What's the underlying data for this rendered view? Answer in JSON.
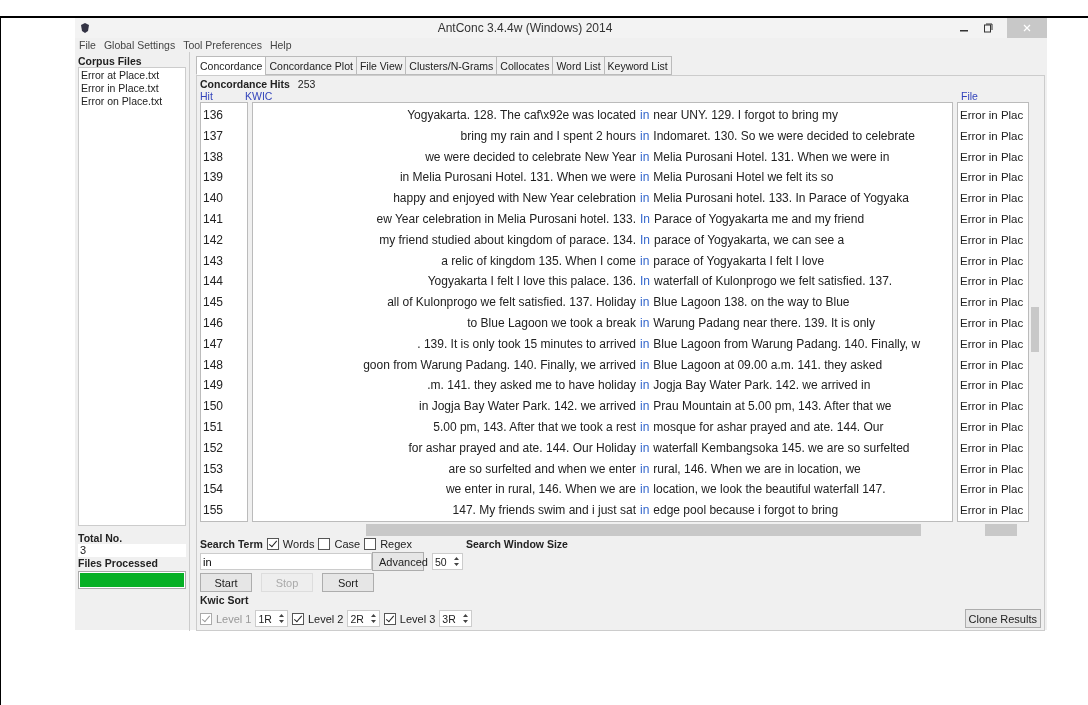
{
  "window": {
    "title": "AntConc 3.4.4w (Windows) 2014"
  },
  "menu": [
    "File",
    "Global Settings",
    "Tool Preferences",
    "Help"
  ],
  "sidebar": {
    "title": "Corpus Files",
    "files": [
      "Error at Place.txt",
      "Error in Place.txt",
      "Error on Place.txt"
    ],
    "total_label": "Total No.",
    "total": "3",
    "processed_label": "Files Processed",
    "progress": {
      "level": 1
    }
  },
  "tabs": [
    {
      "label": "Concordance",
      "selected": true
    },
    {
      "label": "Concordance Plot",
      "selected": false
    },
    {
      "label": "File View",
      "selected": false
    },
    {
      "label": "Clusters/N-Grams",
      "selected": false
    },
    {
      "label": "Collocates",
      "selected": false
    },
    {
      "label": "Word List",
      "selected": false
    },
    {
      "label": "Keyword List",
      "selected": false
    }
  ],
  "hits": {
    "label": "Concordance Hits",
    "count": "253"
  },
  "table": {
    "columns": [
      "Hit",
      "KWIC",
      "File"
    ],
    "rows": [
      {
        "hit": "136",
        "left": "Yogyakarta. 128. The caf\\x92e was located",
        "key": "in",
        "right": "near UNY. 129. I forgot to bring my",
        "file": "Error in Plac"
      },
      {
        "hit": "137",
        "left": "bring my rain and I spent 2 hours",
        "key": "in",
        "right": "Indomaret. 130. So we were decided to celebrate",
        "file": "Error in Plac"
      },
      {
        "hit": "138",
        "left": "we were decided to celebrate New Year",
        "key": "in",
        "right": "Melia Purosani Hotel. 131. When we were in",
        "file": "Error in Plac"
      },
      {
        "hit": "139",
        "left": "in Melia Purosani Hotel. 131. When we were",
        "key": "in",
        "right": "Melia Purosani Hotel we felt its so",
        "file": "Error in Plac"
      },
      {
        "hit": "140",
        "left": "happy and enjoyed with New Year celebration",
        "key": "in",
        "right": "Melia Purosani hotel. 133. In Parace of Yogyaka",
        "file": "Error in Plac"
      },
      {
        "hit": "141",
        "left": "ew Year celebration in Melia Purosani hotel. 133.",
        "key": "In",
        "right": "Parace of Yogyakarta me and my friend",
        "file": "Error in Plac"
      },
      {
        "hit": "142",
        "left": "my friend studied about kingdom of parace. 134.",
        "key": "In",
        "right": "parace of Yogyakarta, we can see a",
        "file": "Error in Plac"
      },
      {
        "hit": "143",
        "left": "a relic of kingdom 135. When I come",
        "key": "in",
        "right": "parace of Yogyakarta I felt I love",
        "file": "Error in Plac"
      },
      {
        "hit": "144",
        "left": "Yogyakarta I felt I love this palace. 136.",
        "key": "In",
        "right": "waterfall of Kulonprogo we felt satisfied. 137.",
        "file": "Error in Plac"
      },
      {
        "hit": "145",
        "left": "all of Kulonprogo we felt satisfied. 137. Holiday",
        "key": "in",
        "right": "Blue Lagoon 138. on the way to Blue",
        "file": "Error in Plac"
      },
      {
        "hit": "146",
        "left": "to Blue Lagoon we took a break",
        "key": "in",
        "right": "Warung Padang near there. 139. It is only",
        "file": "Error in Plac"
      },
      {
        "hit": "147",
        "left": ". 139. It is only took 15 minutes to arrived",
        "key": "in",
        "right": "Blue Lagoon from Warung Padang. 140. Finally, w",
        "file": "Error in Plac"
      },
      {
        "hit": "148",
        "left": "goon from Warung Padang. 140. Finally, we arrived",
        "key": "in",
        "right": "Blue Lagoon at 09.00  a.m. 141. they asked",
        "file": "Error in Plac"
      },
      {
        "hit": "149",
        "left": ".m. 141. they asked me to have holiday",
        "key": "in",
        "right": "Jogja Bay Water Park. 142. we arrived in",
        "file": "Error in Plac"
      },
      {
        "hit": "150",
        "left": "in Jogja Bay Water Park. 142. we arrived",
        "key": "in",
        "right": "Prau Mountain at 5.00 pm, 143. After that we",
        "file": "Error in Plac"
      },
      {
        "hit": "151",
        "left": "5.00 pm, 143. After that we took a rest",
        "key": "in",
        "right": "mosque for ashar prayed and ate. 144. Our",
        "file": "Error in Plac"
      },
      {
        "hit": "152",
        "left": "for ashar prayed and ate. 144. Our Holiday",
        "key": "in",
        "right": "waterfall Kembangsoka 145. we are so surfelted",
        "file": "Error in Plac"
      },
      {
        "hit": "153",
        "left": "are so surfelted and when we enter",
        "key": "in",
        "right": "rural, 146. When we are in location, we",
        "file": "Error in Plac"
      },
      {
        "hit": "154",
        "left": "we enter in rural, 146. When we are",
        "key": "in",
        "right": "location, we look the beautiful waterfall 147.",
        "file": "Error in Plac"
      },
      {
        "hit": "155",
        "left": "147. My friends swim and i just sat",
        "key": "in",
        "right": "edge pool because i forgot to bring",
        "file": "Error in Plac"
      }
    ]
  },
  "search": {
    "label": "Search Term",
    "options": [
      {
        "label": "Words",
        "checked": true
      },
      {
        "label": "Case",
        "checked": false
      },
      {
        "label": "Regex",
        "checked": false
      }
    ],
    "value": "in",
    "advanced": "Advanced",
    "window_label": "Search Window Size",
    "window_size": "50"
  },
  "buttons": [
    {
      "label": "Start",
      "disabled": false
    },
    {
      "label": "Stop",
      "disabled": true
    },
    {
      "label": "Sort",
      "disabled": false
    }
  ],
  "kwic_sort": {
    "label": "Kwic Sort",
    "levels": [
      {
        "label": "Level 1",
        "value": "1R",
        "checked": true,
        "disabled": true
      },
      {
        "label": "Level 2",
        "value": "2R",
        "checked": true,
        "disabled": false
      },
      {
        "label": "Level 3",
        "value": "3R",
        "checked": true,
        "disabled": false
      }
    ]
  },
  "clone": "Clone Results"
}
